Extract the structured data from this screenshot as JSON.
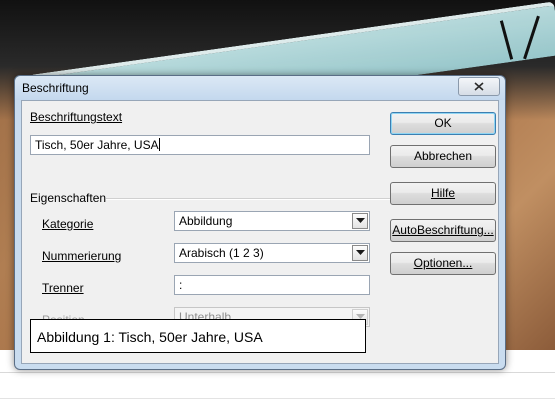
{
  "window": {
    "title": "Beschriftung"
  },
  "caption_text": {
    "label": "Beschriftungstext",
    "value": "Tisch, 50er Jahre, USA"
  },
  "properties": {
    "group_label": "Eigenschaften",
    "category": {
      "label": "Kategorie",
      "value": "Abbildung"
    },
    "numbering": {
      "label": "Nummerierung",
      "value": "Arabisch (1 2 3)"
    },
    "separator": {
      "label": "Trenner",
      "value": ":"
    },
    "position": {
      "label": "Position",
      "value": "Unterhalb",
      "disabled": true
    }
  },
  "buttons": {
    "ok": "OK",
    "cancel": "Abbrechen",
    "help": "Hilfe",
    "autocaption": "AutoBeschriftung...",
    "options": "Optionen..."
  },
  "preview": {
    "text": "Abbildung 1: Tisch, 50er Jahre, USA"
  },
  "icons": {
    "close": "close-icon",
    "dropdown": "chevron-down-icon"
  },
  "colors": {
    "titlebar": "#c4d8ee",
    "client": "#f0f0f0",
    "default_button_border": "#3c7fb1"
  }
}
